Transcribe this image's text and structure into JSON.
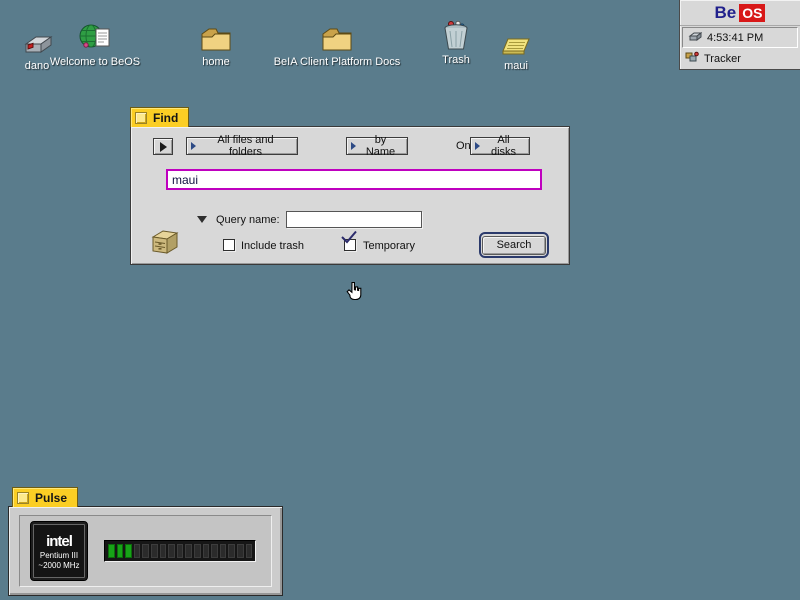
{
  "colors": {
    "desktop_bg": "#5a7c8c",
    "window_bg": "#d8d8d8",
    "tab_yellow": "#fbce24",
    "focus_magenta": "#bf00bf",
    "default_button_ring": "#2b3a6b",
    "led_green": "#17a317",
    "logo_red": "#d81818",
    "logo_blue": "#20208c"
  },
  "desktop": {
    "icons": [
      {
        "label": "dano",
        "icon": "disk-icon"
      },
      {
        "label": "Welcome to BeOS",
        "icon": "globe-document-icon"
      },
      {
        "label": "home",
        "icon": "folder-icon"
      },
      {
        "label": "BeIA Client Platform Docs",
        "icon": "folder-icon"
      },
      {
        "label": "Trash",
        "icon": "trash-icon"
      },
      {
        "label": "maui",
        "icon": "notepad-icon"
      }
    ]
  },
  "deskbar": {
    "logo": {
      "be": "Be",
      "os": "OS"
    },
    "clock": "4:53:41 PM",
    "clock_icon": "disk-icon",
    "tracker": {
      "label": "Tracker",
      "icon": "tracker-icon"
    }
  },
  "find_window": {
    "title": "Find",
    "menus": {
      "scope": "All files and folders",
      "criteria": "by Name",
      "on_label": "On",
      "volume": "All disks"
    },
    "search_field": {
      "value": "maui"
    },
    "query_name": {
      "label": "Query name:",
      "value": ""
    },
    "options": {
      "include_trash": {
        "label": "Include trash",
        "checked": false
      },
      "temporary": {
        "label": "Temporary",
        "checked": true
      }
    },
    "search_button": "Search",
    "drawer_icon": "card-file-icon"
  },
  "pulse_window": {
    "title": "Pulse",
    "cpu": {
      "brand": "intel",
      "model": "Pentium III",
      "speed": "~2000 MHz"
    },
    "load_bar": {
      "segments_total": 17,
      "segments_lit": 3
    }
  },
  "cursor": {
    "type": "hand-cursor"
  }
}
